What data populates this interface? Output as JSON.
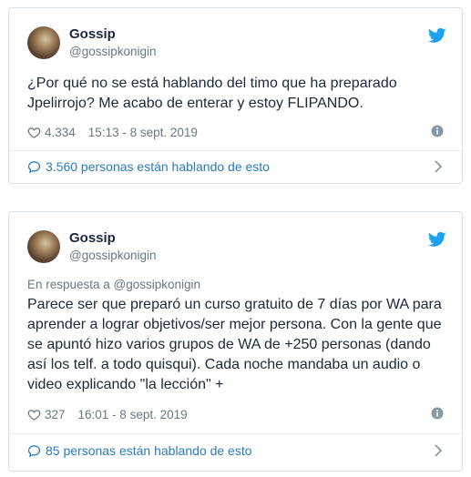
{
  "tweets": [
    {
      "name": "Gossip",
      "handle": "@gossipkonigin",
      "reply_to": "",
      "text": "¿Por qué no se está hablando del timo que ha preparado Jpelirrojo? Me acabo de enterar y estoy FLIPANDO.",
      "likes": "4.334",
      "timestamp": "15:13 - 8 sept. 2019",
      "conversation": "3.560 personas están hablando de esto"
    },
    {
      "name": "Gossip",
      "handle": "@gossipkonigin",
      "reply_to": "En respuesta a @gossipkonigin",
      "text": "Parece ser que preparó un curso gratuito de 7 días por WA para aprender a lograr objetivos/ser mejor persona. Con la gente que se apuntó hizo varios grupos de WA de +250 personas (dando así los telf. a todo quisqui). Cada noche mandaba un audio o video explicando \"la lección\" +",
      "likes": "327",
      "timestamp": "16:01 - 8 sept. 2019",
      "conversation": "85 personas están hablando de esto"
    }
  ],
  "colors": {
    "link": "#2b7bb9",
    "twitter_blue": "#1da1f2",
    "text": "#1c2938",
    "muted": "#697882",
    "border": "#d9e0e6"
  },
  "icons": [
    "twitter-bird-icon",
    "heart-icon",
    "info-icon",
    "speech-bubble-icon",
    "chevron-right-icon"
  ]
}
